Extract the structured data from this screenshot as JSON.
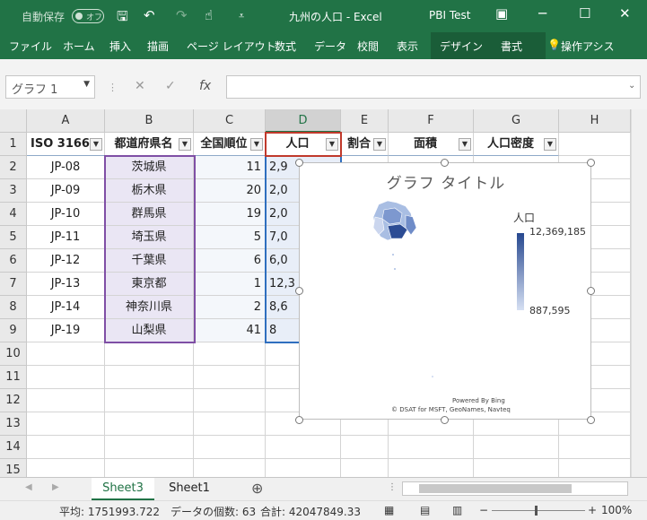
{
  "titlebar": {
    "autosave": "自動保存",
    "autosave_state": "オフ",
    "doc_title": "九州の人口 - Excel",
    "user": "PBI Test"
  },
  "ribbon": {
    "tabs": [
      "ファイル",
      "ホーム",
      "挿入",
      "描画",
      "ページ レイアウト",
      "数式",
      "データ",
      "校閲",
      "表示",
      "デザイン",
      "書式"
    ],
    "tellme": "操作アシス"
  },
  "formula": {
    "namebox": "グラフ 1",
    "fx": "fx"
  },
  "columns": [
    "A",
    "B",
    "C",
    "D",
    "E",
    "F",
    "G",
    "H"
  ],
  "rows": [
    "1",
    "2",
    "3",
    "4",
    "5",
    "6",
    "7",
    "8",
    "9",
    "10",
    "11",
    "12",
    "13",
    "14",
    "15"
  ],
  "table": {
    "headers": [
      "ISO 3166",
      "都道府県名",
      "全国順位",
      "人口",
      "割合",
      "面積",
      "人口密度"
    ],
    "rows": [
      {
        "iso": "JP-08",
        "pref": "茨城県",
        "rank": "11",
        "pop": "2,9"
      },
      {
        "iso": "JP-09",
        "pref": "栃木県",
        "rank": "20",
        "pop": "2,0"
      },
      {
        "iso": "JP-10",
        "pref": "群馬県",
        "rank": "19",
        "pop": "2,0"
      },
      {
        "iso": "JP-11",
        "pref": "埼玉県",
        "rank": "5",
        "pop": "7,0"
      },
      {
        "iso": "JP-12",
        "pref": "千葉県",
        "rank": "6",
        "pop": "6,0"
      },
      {
        "iso": "JP-13",
        "pref": "東京都",
        "rank": "1",
        "pop": "12,3"
      },
      {
        "iso": "JP-14",
        "pref": "神奈川県",
        "rank": "2",
        "pop": "8,6"
      },
      {
        "iso": "JP-19",
        "pref": "山梨県",
        "rank": "41",
        "pop": "8"
      }
    ]
  },
  "chart": {
    "title": "グラフ タイトル",
    "legend_title": "人口",
    "legend_max": "12,369,185",
    "legend_min": "887,595",
    "powered": "Powered By Bing",
    "copyright": "© DSAT for MSFT, GeoNames, Navteq"
  },
  "sheets": [
    "Sheet3",
    "Sheet1"
  ],
  "status": {
    "average": "平均: 1751993.722",
    "count": "データの個数: 63",
    "sum": "合計: 42047849.33",
    "zoom": "100%"
  },
  "colors": {
    "accent": "#217346",
    "legend_dark": "#27488f",
    "legend_light": "#d6e0f3"
  }
}
